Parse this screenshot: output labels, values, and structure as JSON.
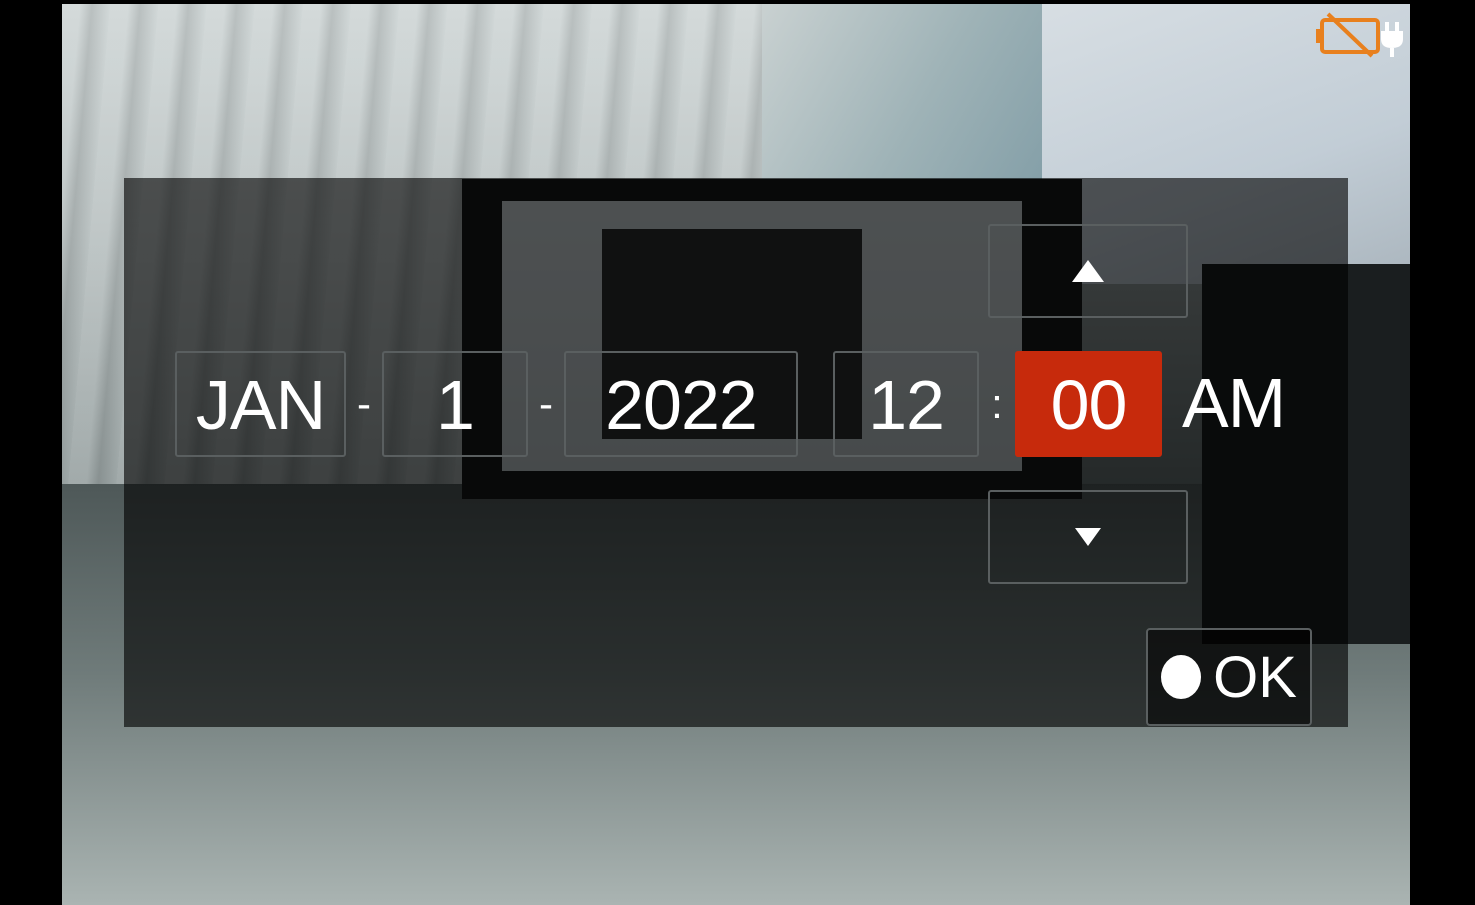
{
  "date_time_setting": {
    "month": "JAN",
    "day": "1",
    "year": "2022",
    "hour": "12",
    "minute": "00",
    "ampm": "AM",
    "date_separator": "-",
    "time_separator": ":",
    "selected_field": "minute"
  },
  "controls": {
    "up_icon": "triangle-up-icon",
    "down_icon": "triangle-down-icon",
    "ok_label": "OK",
    "ok_icon": "round-button-icon"
  },
  "status": {
    "battery_icon": "battery-empty-icon",
    "power_icon": "ac-plug-icon"
  },
  "colors": {
    "selected": "#c72a0c",
    "battery_warning": "#e8801e",
    "panel_border": "#5a5f60"
  }
}
